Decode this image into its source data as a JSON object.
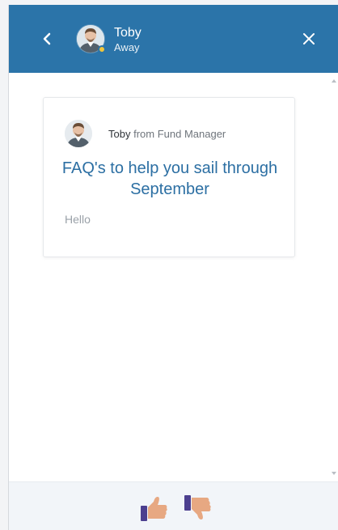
{
  "header": {
    "back_icon": "chevron-left-icon",
    "close_icon": "close-icon",
    "agent_name": "Toby",
    "agent_status": "Away",
    "presence_color": "#f0c53c",
    "background_color": "#2b74a9"
  },
  "message_card": {
    "author_name": "Toby",
    "author_source": "from Fund Manager",
    "title": "FAQ's to help you sail through September",
    "body": "Hello",
    "title_color": "#2c6fa3"
  },
  "feedback": {
    "thumbs_up_icon": "thumbs-up-icon",
    "thumbs_down_icon": "thumbs-down-icon",
    "skin_color": "#e7a882",
    "cuff_color": "#4c3f8f"
  }
}
